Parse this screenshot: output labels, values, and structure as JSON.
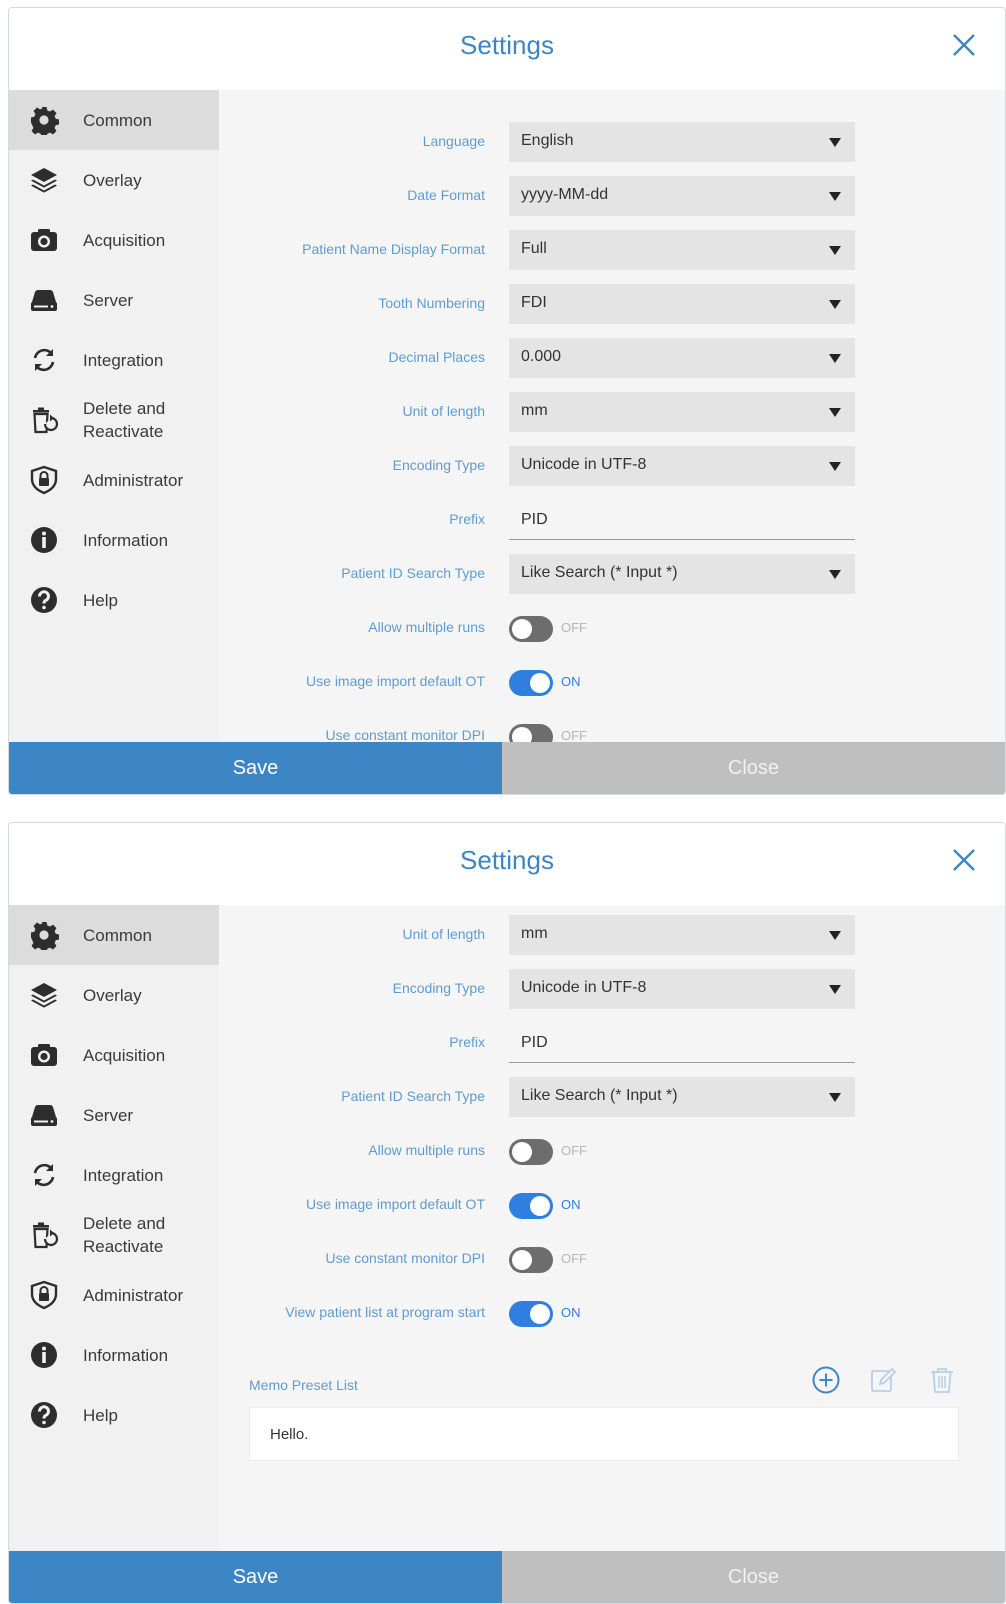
{
  "settings_title": "Settings",
  "sidebar": {
    "items": [
      {
        "id": "common",
        "label": "Common",
        "icon": "gear-icon"
      },
      {
        "id": "overlay",
        "label": "Overlay",
        "icon": "layers-icon"
      },
      {
        "id": "acquisition",
        "label": "Acquisition",
        "icon": "camera-icon"
      },
      {
        "id": "server",
        "label": "Server",
        "icon": "server-icon"
      },
      {
        "id": "integration",
        "label": "Integration",
        "icon": "sync-icon"
      },
      {
        "id": "delete",
        "label_line1": "Delete and",
        "label_line2": "Reactivate",
        "icon": "trash-restore-icon"
      },
      {
        "id": "administrator",
        "label": "Administrator",
        "icon": "lock-shield-icon"
      },
      {
        "id": "information",
        "label": "Information",
        "icon": "info-icon"
      },
      {
        "id": "help",
        "label": "Help",
        "icon": "help-icon"
      }
    ],
    "active": "Common"
  },
  "fields": {
    "language": {
      "label": "Language",
      "value": "English"
    },
    "date_format": {
      "label": "Date Format",
      "value": "yyyy-MM-dd"
    },
    "patient_name_format": {
      "label": "Patient Name Display Format",
      "value": "Full"
    },
    "tooth_numbering": {
      "label": "Tooth Numbering",
      "value": "FDI"
    },
    "decimal_places": {
      "label": "Decimal Places",
      "value": "0.000"
    },
    "unit_of_length": {
      "label": "Unit of length",
      "value": "mm"
    },
    "encoding_type": {
      "label": "Encoding Type",
      "value": "Unicode in UTF-8"
    },
    "prefix": {
      "label": "Prefix",
      "value": "PID"
    },
    "patient_id_search": {
      "label": "Patient ID Search Type",
      "value": "Like Search (* Input *)"
    },
    "allow_multiple_runs": {
      "label": "Allow multiple runs",
      "state": "OFF"
    },
    "use_image_import_default_ot": {
      "label": "Use image import default OT",
      "state": "ON"
    },
    "use_constant_monitor_dpi": {
      "label": "Use constant monitor DPI",
      "state": "OFF"
    },
    "view_patient_list": {
      "label": "View patient list at program start",
      "state": "ON"
    }
  },
  "memo": {
    "label": "Memo Preset List",
    "items": [
      "Hello."
    ],
    "icons": [
      "add-circle-icon",
      "edit-icon",
      "delete-icon"
    ]
  },
  "footer": {
    "save_label": "Save",
    "close_label": "Close"
  },
  "colors": {
    "accent": "#3d86c6",
    "label_blue": "#5f9bd1",
    "toggle_on": "#2f7fe0",
    "toggle_off": "#6d6d6d",
    "close_button": "#bfbfbf",
    "sidebar_bg": "#f1f1f1",
    "sidebar_active": "#dcdcdc"
  }
}
